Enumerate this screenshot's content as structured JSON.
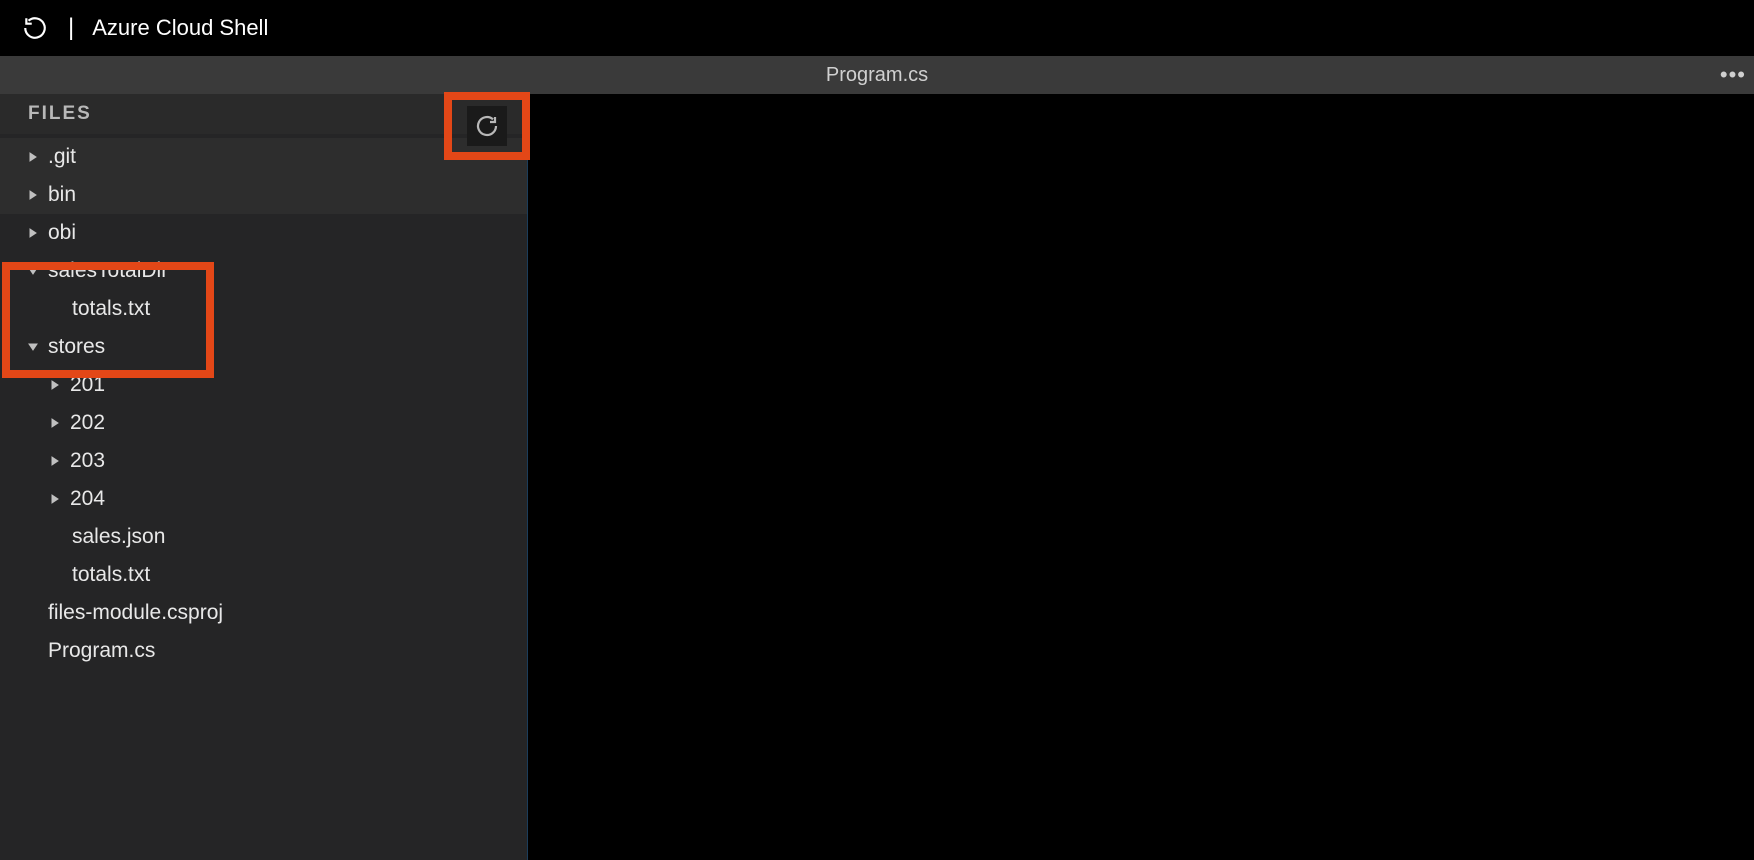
{
  "topbar": {
    "title": "Azure Cloud Shell"
  },
  "tab": {
    "filename": "Program.cs"
  },
  "sidebar": {
    "header": "FILES",
    "items": [
      {
        "label": ".git",
        "type": "folder-closed",
        "indent": 0,
        "alt": true
      },
      {
        "label": "bin",
        "type": "folder-closed",
        "indent": 0,
        "alt": true
      },
      {
        "label": "obi",
        "type": "folder-closed",
        "indent": 0,
        "alt": false
      },
      {
        "label": "salesTotalDir",
        "type": "folder-open",
        "indent": 0,
        "alt": false
      },
      {
        "label": "totals.txt",
        "type": "file",
        "indent": 2,
        "alt": false
      },
      {
        "label": "stores",
        "type": "folder-open",
        "indent": 0,
        "alt": false
      },
      {
        "label": "201",
        "type": "folder-closed",
        "indent": 1,
        "alt": false
      },
      {
        "label": "202",
        "type": "folder-closed",
        "indent": 1,
        "alt": false
      },
      {
        "label": "203",
        "type": "folder-closed",
        "indent": 1,
        "alt": false
      },
      {
        "label": "204",
        "type": "folder-closed",
        "indent": 1,
        "alt": false
      },
      {
        "label": "sales.json",
        "type": "file",
        "indent": 2,
        "alt": false
      },
      {
        "label": "totals.txt",
        "type": "file",
        "indent": 2,
        "alt": false
      },
      {
        "label": "files-module.csproj",
        "type": "file",
        "indent": 0,
        "alt": false,
        "noarrow": true
      },
      {
        "label": "Program.cs",
        "type": "file",
        "indent": 0,
        "alt": false,
        "noarrow": true
      }
    ]
  }
}
